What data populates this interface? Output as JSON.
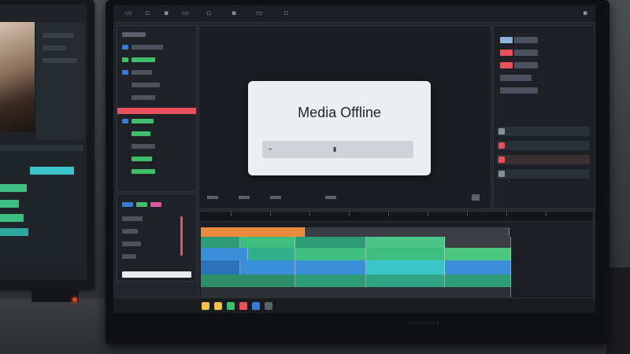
{
  "viewer": {
    "offline_title": "Media Offline",
    "field_left_glyph": "⌁",
    "field_center_glyph": "▮"
  },
  "monitor": {
    "brand_text": "........"
  },
  "colors": {
    "accent_red": "#e8505b",
    "clip_orange": "#e98a3c",
    "clip_green": "#3fbf7f",
    "clip_blue": "#3b8fd8",
    "clip_teal": "#39c5c9",
    "label_green": "#3fbf6a",
    "label_blue": "#3a7bd5",
    "label_pink": "#e056a0"
  },
  "icons": {
    "menu": [
      "file-icon",
      "edit-icon",
      "clip-icon",
      "sequence-icon",
      "marker-icon",
      "graphics-icon",
      "view-icon",
      "window-icon",
      "help-icon"
    ],
    "task": [
      "start-icon",
      "search-icon",
      "folder-icon",
      "browser-icon",
      "mail-icon",
      "app-icon"
    ]
  }
}
